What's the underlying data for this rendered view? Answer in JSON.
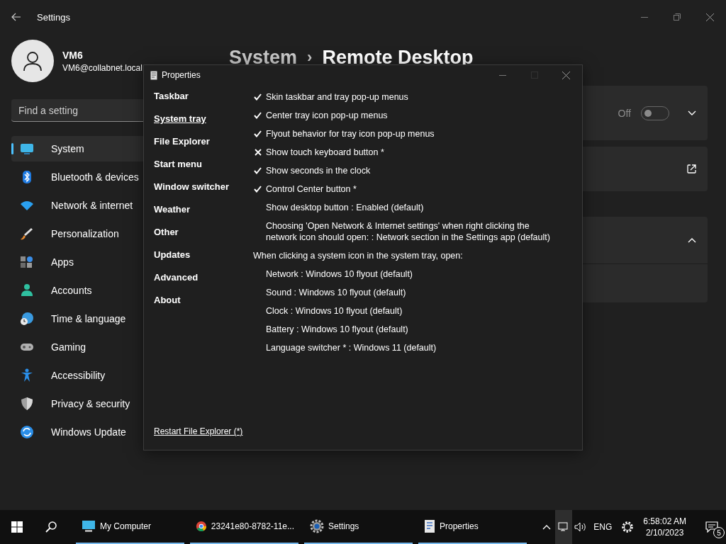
{
  "settings": {
    "title": "Settings",
    "user": {
      "name": "VM6",
      "email": "VM6@collabnet.local"
    },
    "search": {
      "placeholder": "Find a setting"
    },
    "nav": [
      {
        "label": "System",
        "selected": true
      },
      {
        "label": "Bluetooth & devices",
        "selected": false
      },
      {
        "label": "Network & internet",
        "selected": false
      },
      {
        "label": "Personalization",
        "selected": false
      },
      {
        "label": "Apps",
        "selected": false
      },
      {
        "label": "Accounts",
        "selected": false
      },
      {
        "label": "Time & language",
        "selected": false
      },
      {
        "label": "Gaming",
        "selected": false
      },
      {
        "label": "Accessibility",
        "selected": false
      },
      {
        "label": "Privacy & security",
        "selected": false
      },
      {
        "label": "Windows Update",
        "selected": false
      }
    ],
    "breadcrumb": {
      "parent": "System",
      "separator": "›",
      "current": "Remote Desktop"
    },
    "cards": [
      {
        "kind": "toggle",
        "state_label": "Off",
        "on": false
      },
      {
        "kind": "link"
      },
      {
        "kind": "expander",
        "expanded": true
      },
      {
        "kind": "blank"
      }
    ]
  },
  "dialog": {
    "title": "Properties",
    "nav": [
      {
        "label": "Taskbar",
        "selected": false
      },
      {
        "label": "System tray",
        "selected": true
      },
      {
        "label": "File Explorer",
        "selected": false
      },
      {
        "label": "Start menu",
        "selected": false
      },
      {
        "label": "Window switcher",
        "selected": false
      },
      {
        "label": "Weather",
        "selected": false
      },
      {
        "label": "Other",
        "selected": false
      },
      {
        "label": "Updates",
        "selected": false
      },
      {
        "label": "Advanced",
        "selected": false
      },
      {
        "label": "About",
        "selected": false
      }
    ],
    "options": [
      {
        "kind": "check",
        "checked": true,
        "text": "Skin taskbar and tray pop-up menus"
      },
      {
        "kind": "check",
        "checked": true,
        "text": "Center tray icon pop-up menus"
      },
      {
        "kind": "check",
        "checked": true,
        "text": "Flyout behavior for tray icon pop-up menus"
      },
      {
        "kind": "check",
        "checked": false,
        "text": "Show touch keyboard button *"
      },
      {
        "kind": "check",
        "checked": true,
        "text": "Show seconds in the clock"
      },
      {
        "kind": "check",
        "checked": true,
        "text": "Control Center button *"
      },
      {
        "kind": "choice",
        "text": "Show desktop button : Enabled (default)"
      },
      {
        "kind": "choice",
        "text": "Choosing 'Open Network & Internet settings' when right clicking the network icon should open: : Network section in the Settings app (default)"
      },
      {
        "kind": "heading",
        "text": "When clicking a system icon in the system tray, open:"
      },
      {
        "kind": "choice",
        "text": "Network : Windows 10 flyout (default)"
      },
      {
        "kind": "choice",
        "text": "Sound : Windows 10 flyout (default)"
      },
      {
        "kind": "choice",
        "text": "Clock : Windows 10 flyout (default)"
      },
      {
        "kind": "choice",
        "text": "Battery : Windows 10 flyout (default)"
      },
      {
        "kind": "choice",
        "text": "Language switcher * : Windows 11 (default)"
      }
    ],
    "footer_link": "Restart File Explorer (*)"
  },
  "taskbar": {
    "apps": [
      {
        "label": "My Computer",
        "active": true
      },
      {
        "label": "23241e80-8782-11e...",
        "active": true
      },
      {
        "label": "Settings",
        "active": true
      },
      {
        "label": "Properties",
        "active": true
      }
    ],
    "language": "ENG",
    "time": "6:58:02 AM",
    "date": "2/10/2023",
    "notifications": "5"
  }
}
